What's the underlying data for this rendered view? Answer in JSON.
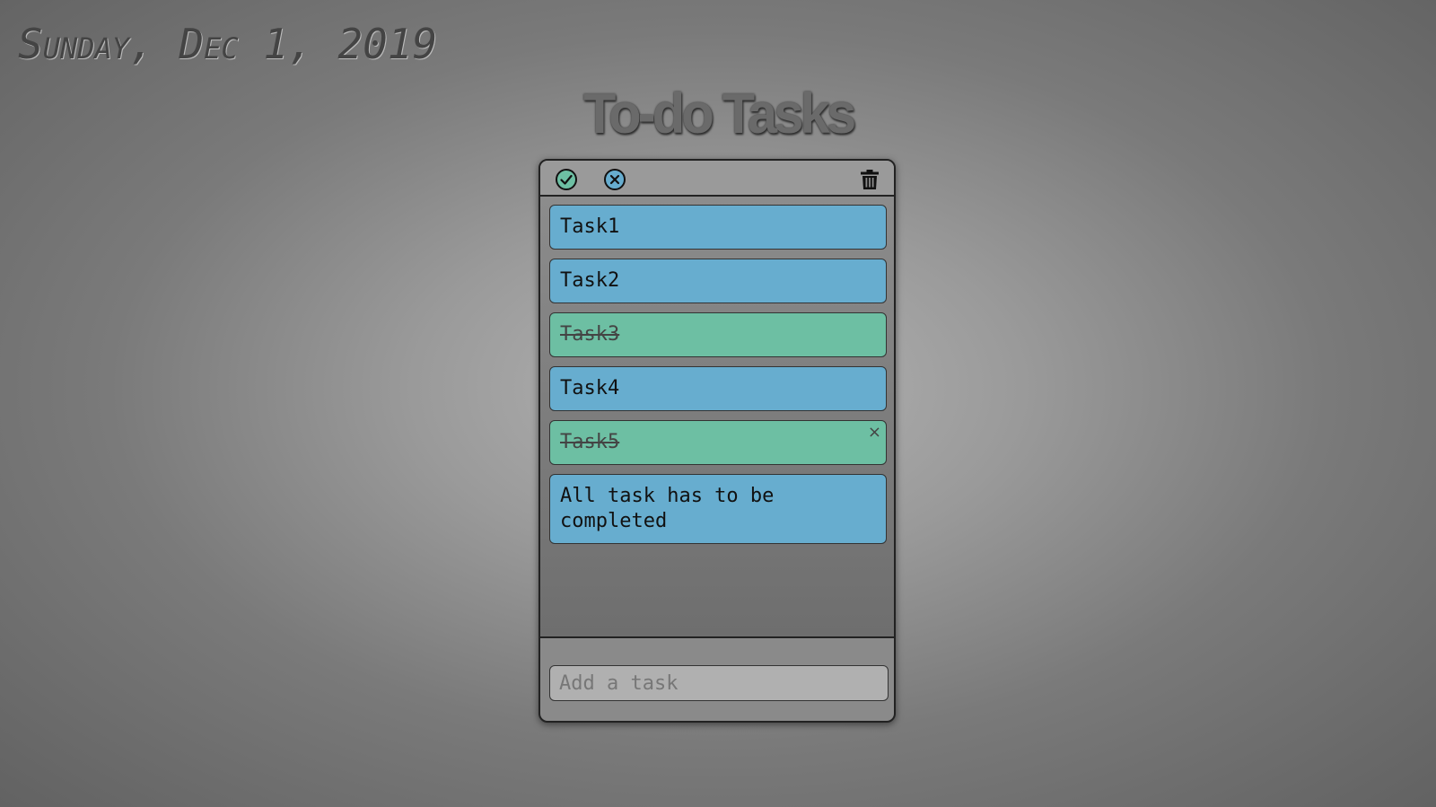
{
  "header": {
    "date": "Sunday, Dec 1, 2019",
    "title": "To-do Tasks"
  },
  "toolbar": {
    "complete_all_icon": "check-circle-icon",
    "clear_completed_icon": "x-circle-icon",
    "delete_all_icon": "trash-icon"
  },
  "tasks": [
    {
      "text": "Task1",
      "completed": false
    },
    {
      "text": "Task2",
      "completed": false
    },
    {
      "text": "Task3",
      "completed": true
    },
    {
      "text": "Task4",
      "completed": false
    },
    {
      "text": "Task5",
      "completed": true,
      "close_label": "×"
    },
    {
      "text": "All task has to be completed",
      "completed": false
    }
  ],
  "add_task": {
    "placeholder": "Add a task",
    "value": ""
  },
  "colors": {
    "todo": "#67adcf",
    "done": "#6dbfa3",
    "check_icon": "#2e8f6a",
    "x_icon": "#2a79a8"
  }
}
